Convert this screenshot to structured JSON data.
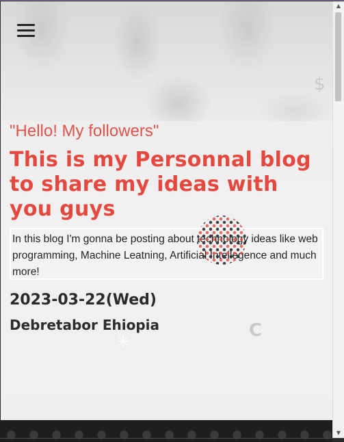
{
  "menu": {
    "icon": "hamburger-menu-icon"
  },
  "hero": {
    "greeting": "\"Hello! My followers\"",
    "headline": "This is my Personnal blog to share my ideas with you guys",
    "intro": "In this blog I'm gonna be posting about technology ideas like web programming, Machine Leatning, Artificial Intellegence and much more!",
    "date": "2023-03-22(Wed)",
    "location": "Debretabor Ehiopia"
  },
  "colors": {
    "accent": "#e5483e",
    "text_dark": "#2b2b2b",
    "footer_bg": "#1e1e1e"
  }
}
